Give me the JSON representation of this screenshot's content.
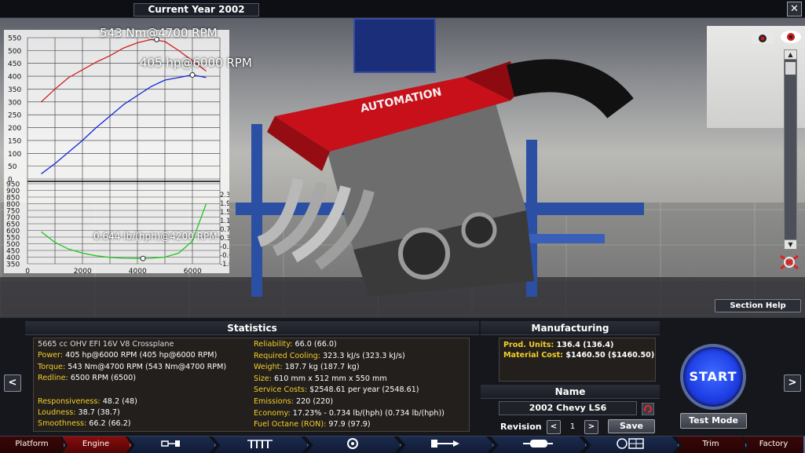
{
  "top_bar": {
    "year_label": "Current Year 2002",
    "close_label": "✕"
  },
  "viewport": {
    "section_help_label": "Section Help",
    "camera_icon": "camera-icon",
    "eye_icon": "eye-icon",
    "scroll_up_label": "▲",
    "scroll_down_label": "▼"
  },
  "chart_data": {
    "type": "line",
    "top_panel": {
      "x_range": [
        0,
        7000
      ],
      "y_range": [
        0,
        550
      ],
      "y_ticks": [
        "550",
        "500",
        "450",
        "400",
        "350",
        "300",
        "250",
        "200",
        "150",
        "100",
        "50",
        "0"
      ],
      "annotations": {
        "torque_peak": "543 Nm@4700 RPM",
        "power_peak": "405 hp@6000 RPM"
      },
      "series": [
        {
          "color": "#d01f1f",
          "x": [
            500,
            1000,
            1500,
            2000,
            2500,
            3000,
            3500,
            4000,
            4500,
            5000,
            5500,
            6000,
            6500
          ],
          "values": [
            300,
            350,
            395,
            425,
            455,
            480,
            510,
            530,
            543,
            535,
            500,
            460,
            420
          ]
        },
        {
          "color": "#1428d6",
          "x": [
            500,
            1000,
            1500,
            2000,
            2500,
            3000,
            3500,
            4000,
            4500,
            5000,
            5500,
            6000,
            6500
          ],
          "values": [
            20,
            60,
            105,
            150,
            200,
            245,
            290,
            325,
            360,
            385,
            395,
            405,
            395
          ]
        }
      ]
    },
    "bottom_panel": {
      "x_range": [
        0,
        7000
      ],
      "y_range": [
        350,
        950
      ],
      "y_ticks_left": [
        "950",
        "900",
        "850",
        "800",
        "750",
        "700",
        "650",
        "600",
        "550",
        "500",
        "450",
        "400",
        "350"
      ],
      "y_ticks_right": [
        "2.3",
        "1.9",
        "1.5",
        "1.1",
        "0.7",
        "0.3",
        "-0.3",
        "-0.6",
        "-1.0"
      ],
      "x_ticks": [
        "0",
        "2000",
        "4000",
        "6000"
      ],
      "annotation": "0.644 lb/(hph)@4200 RPM",
      "series": [
        {
          "color": "#22c422",
          "x": [
            500,
            1000,
            1500,
            2000,
            2500,
            3000,
            3500,
            4000,
            4500,
            5000,
            5500,
            6000,
            6500
          ],
          "values": [
            590,
            510,
            460,
            430,
            410,
            398,
            392,
            390,
            392,
            400,
            430,
            520,
            800
          ]
        }
      ]
    }
  },
  "statistics": {
    "title": "Statistics",
    "engine_desc": "5665 cc OHV EFI 16V V8 Crossplane",
    "left": [
      {
        "key": "Power: ",
        "value": "405 hp@6000 RPM",
        "paren": " (405 hp@6000 RPM)"
      },
      {
        "key": "Torque: ",
        "value": "543 Nm@4700 RPM",
        "paren": " (543 Nm@4700 RPM)"
      },
      {
        "key": "Redline: ",
        "value": "6500 RPM",
        "paren": " (6500)"
      },
      {
        "key": "Responsiveness: ",
        "value": "48.2",
        "paren": " (48)"
      },
      {
        "key": "Loudness: ",
        "value": "38.7",
        "paren": " (38.7)"
      },
      {
        "key": "Smoothness: ",
        "value": "66.2",
        "paren": " (66.2)"
      }
    ],
    "right": [
      {
        "key": "Reliability: ",
        "value": "66.0",
        "paren": " (66.0)"
      },
      {
        "key": "Required Cooling: ",
        "value": "323.3 kJ/s",
        "paren": " (323.3 kJ/s)"
      },
      {
        "key": "Weight: ",
        "value": "187.7 kg",
        "paren": " (187.7 kg)"
      },
      {
        "key": "Size: ",
        "value": "610 mm x 512 mm x 550 mm",
        "paren": ""
      },
      {
        "key": "Service Costs: ",
        "value": "$2548.61 per year",
        "paren": " (2548.61)"
      },
      {
        "key": "Emissions: ",
        "value": "220",
        "paren": " (220)"
      },
      {
        "key": "Economy: ",
        "value": "17.23% - 0.734 lb/(hph)",
        "paren": " (0.734 lb/(hph))"
      },
      {
        "key": "Fuel Octane (RON): ",
        "value": "97.9",
        "paren": " (97.9)"
      }
    ]
  },
  "manufacturing": {
    "title": "Manufacturing",
    "items": [
      {
        "key": "Prod. Units: ",
        "value": "136.4",
        "paren": " (136.4)"
      },
      {
        "key": "Material Cost: ",
        "value": "$1460.50",
        "paren": " ($1460.50)"
      }
    ]
  },
  "name_section": {
    "title": "Name",
    "engine_name": "2002 Chevy LS6",
    "revision_label": "Revision",
    "revision_value": "1",
    "prev_label": "<",
    "next_label": ">",
    "save_label": "Save"
  },
  "actions": {
    "start_label": "START",
    "test_mode_label": "Test Mode",
    "left_arrow": "<",
    "right_arrow": ">"
  },
  "nav": {
    "tabs": [
      {
        "label": "Platform"
      },
      {
        "label": "Engine"
      },
      {
        "label": ""
      },
      {
        "label": ""
      },
      {
        "label": ""
      },
      {
        "label": ""
      },
      {
        "label": ""
      },
      {
        "label": ""
      },
      {
        "label": "Trim"
      },
      {
        "label": "Factory"
      }
    ]
  }
}
